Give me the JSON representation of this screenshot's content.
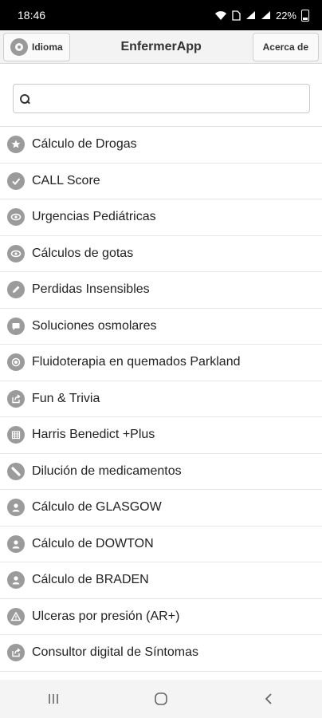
{
  "status_bar": {
    "time": "18:46",
    "battery": "22%"
  },
  "header": {
    "left_button": "Idioma",
    "title": "EnfermerApp",
    "right_button": "Acerca de"
  },
  "search": {
    "placeholder": "",
    "value": ""
  },
  "list": {
    "items": [
      {
        "label": "Cálculo de Drogas",
        "icon": "star-icon"
      },
      {
        "label": "CALL Score",
        "icon": "check-icon"
      },
      {
        "label": "Urgencias Pediátricas",
        "icon": "eye-icon"
      },
      {
        "label": "Cálculos de gotas",
        "icon": "eye-icon"
      },
      {
        "label": "Perdidas Insensibles",
        "icon": "pencil-icon"
      },
      {
        "label": "Soluciones osmolares",
        "icon": "comment-icon"
      },
      {
        "label": "Fluidoterapia en quemados Parkland",
        "icon": "record-icon"
      },
      {
        "label": "Fun & Trivia",
        "icon": "share-icon"
      },
      {
        "label": "Harris Benedict +Plus",
        "icon": "grid-icon"
      },
      {
        "label": "Dilución de medicamentos",
        "icon": "forbidden-icon"
      },
      {
        "label": "Cálculo de GLASGOW",
        "icon": "user-icon"
      },
      {
        "label": "Cálculo de DOWTON",
        "icon": "user-icon"
      },
      {
        "label": "Cálculo de BRADEN",
        "icon": "user-icon"
      },
      {
        "label": "Ulceras por presión (AR+)",
        "icon": "alert-icon"
      },
      {
        "label": "Consultor digital de Síntomas",
        "icon": "share-icon"
      }
    ]
  }
}
